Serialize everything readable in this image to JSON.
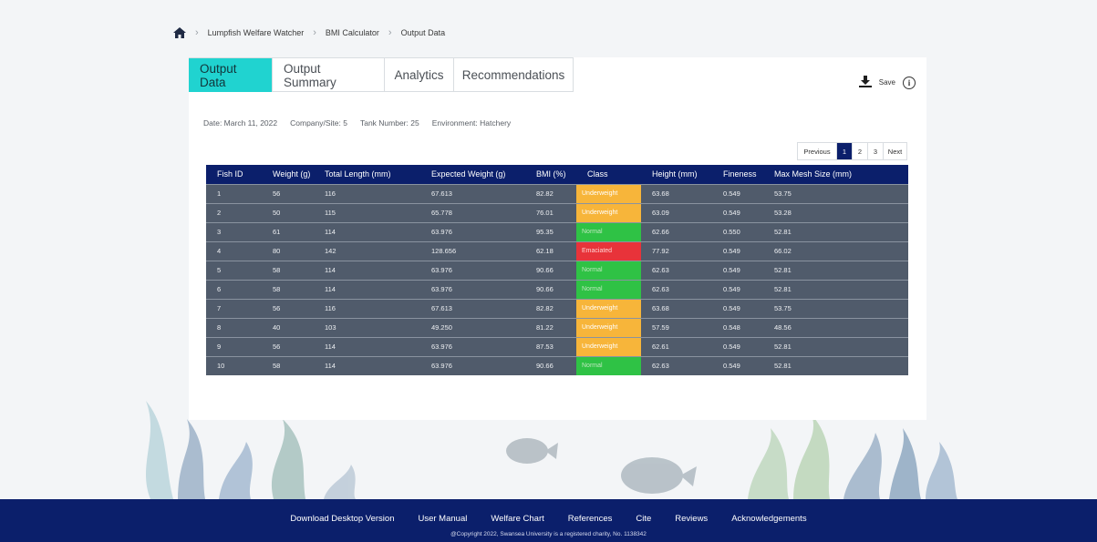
{
  "breadcrumb": {
    "items": [
      "Lumpfish Welfare Watcher",
      "BMI Calculator",
      "Output Data"
    ]
  },
  "tabs": [
    {
      "label": "Output Data",
      "active": true
    },
    {
      "label": "Output Summary",
      "active": false
    },
    {
      "label": "Analytics",
      "active": false
    },
    {
      "label": "Recommendations",
      "active": false
    }
  ],
  "actions": {
    "save_label": "Save",
    "save_icon": "download-icon",
    "info_icon": "info-icon",
    "info_glyph": "i"
  },
  "meta": {
    "date": "Date: March 11, 2022",
    "company": "Company/Site: 5",
    "tank": "Tank Number: 25",
    "environment": "Environment: Hatchery"
  },
  "pagination": {
    "previous": "Previous",
    "pages": [
      "1",
      "2",
      "3"
    ],
    "current": "1",
    "next": "Next"
  },
  "table": {
    "columns": [
      "Fish ID",
      "Weight (g)",
      "Total Length (mm)",
      "Expected Weight (g)",
      "BMI (%)",
      "Class",
      "Height (mm)",
      "Fineness",
      "Max Mesh Size (mm)"
    ],
    "rows": [
      [
        "1",
        "56",
        "116",
        "67.613",
        "82.82",
        "Underweight",
        "63.68",
        "0.549",
        "53.75"
      ],
      [
        "2",
        "50",
        "115",
        "65.778",
        "76.01",
        "Underweight",
        "63.09",
        "0.549",
        "53.28"
      ],
      [
        "3",
        "61",
        "114",
        "63.976",
        "95.35",
        "Normal",
        "62.66",
        "0.550",
        "52.81"
      ],
      [
        "4",
        "80",
        "142",
        "128.656",
        "62.18",
        "Emaciated",
        "77.92",
        "0.549",
        "66.02"
      ],
      [
        "5",
        "58",
        "114",
        "63.976",
        "90.66",
        "Normal",
        "62.63",
        "0.549",
        "52.81"
      ],
      [
        "6",
        "58",
        "114",
        "63.976",
        "90.66",
        "Normal",
        "62.63",
        "0.549",
        "52.81"
      ],
      [
        "7",
        "56",
        "116",
        "67.613",
        "82.82",
        "Underweight",
        "63.68",
        "0.549",
        "53.75"
      ],
      [
        "8",
        "40",
        "103",
        "49.250",
        "81.22",
        "Underweight",
        "57.59",
        "0.548",
        "48.56"
      ],
      [
        "9",
        "56",
        "114",
        "63.976",
        "87.53",
        "Underweight",
        "62.61",
        "0.549",
        "52.81"
      ],
      [
        "10",
        "58",
        "114",
        "63.976",
        "90.66",
        "Normal",
        "62.63",
        "0.549",
        "52.81"
      ]
    ]
  },
  "footer": {
    "links": [
      "Download Desktop Version",
      "User Manual",
      "Welfare Chart",
      "References",
      "Cite",
      "Reviews",
      "Acknowledgements"
    ],
    "copyright": "@Copyright 2022, Swansea University is a registered charity, No. 1138342"
  },
  "colors": {
    "accent_tab": "#20d3d0",
    "navy": "#0b1f6b",
    "row_bg": "#505b6b",
    "underweight": "#f7b53a",
    "normal": "#2fc245",
    "emaciated": "#e8333a"
  }
}
